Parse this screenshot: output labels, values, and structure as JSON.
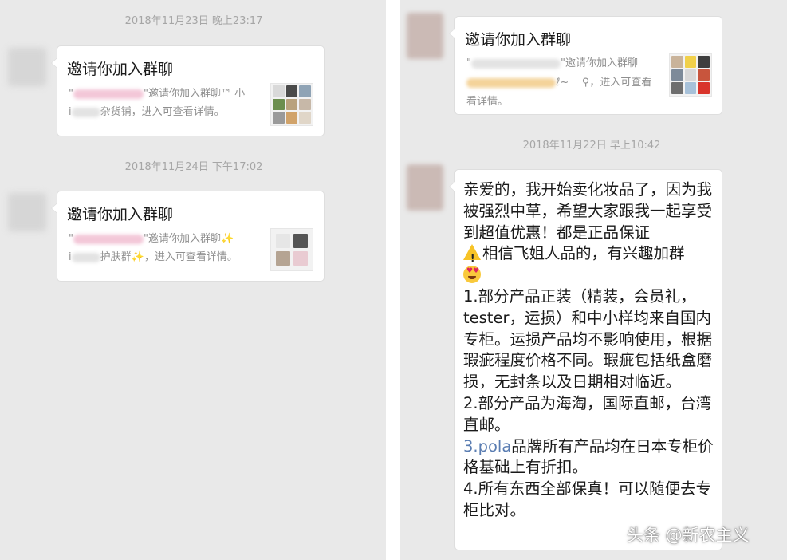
{
  "left": {
    "timestamps": [
      "2018年11月23日 晚上23:17",
      "2018年11月24日 下午17:02"
    ],
    "invites": [
      {
        "title": "邀请你加入群聊",
        "line1_prefix": "\"",
        "line1_text": "\"邀请你加入群聊",
        "line1_suffix": "™ 小",
        "line2_prefix": "i",
        "line2_text": "杂货铺，进入可查看详情。"
      },
      {
        "title": "邀请你加入群聊",
        "line1_prefix": "\"",
        "line1_text": "\"邀请你加入群聊",
        "line1_suffix": "✨",
        "line2_prefix": "i",
        "line2_text": "护肤群",
        "line2_spark": "✨",
        "line2_tail": "，进入可查看详情。"
      }
    ]
  },
  "right": {
    "invite": {
      "title": "邀请你加入群聊",
      "line1_prefix": "\"",
      "line1_text": "\"邀请你加入群聊",
      "line2_mid": "ℓ~",
      "line2_text": "♀，进入可查看",
      "line3_text": "看详情。"
    },
    "timestamp": "2018年11月22日 早上10:42",
    "message": {
      "p1_a": "亲爱的，我开始卖化妆品了，因为我被强烈中草，希望大家跟我一起享受到超值优惠！都是正品保证",
      "p1_b": "相信飞姐人品的，有兴趣加群",
      "p2": "1.部分产品正装（精装，会员礼，tester，运损）和中小样均来自国内专柜。运损产品均不影响使用，根据瑕疵程度价格不同。瑕疵包括纸盒磨损，无封条以及日期相对临近。",
      "p3": "2.部分产品为海淘，国际直邮，台湾直邮。",
      "p4_link": "3.pola",
      "p4_rest": "品牌所有产品均在日本专柜价格基础上有折扣。",
      "p5": "4.所有东西全部保真！可以随便去专柜比对。"
    }
  },
  "watermark": "头条 @新农主义",
  "colors": {
    "panel_bg": "#e9e9e9",
    "bubble_bg": "#ffffff",
    "timestamp": "#a6a6a6",
    "link": "#5a7db2"
  }
}
